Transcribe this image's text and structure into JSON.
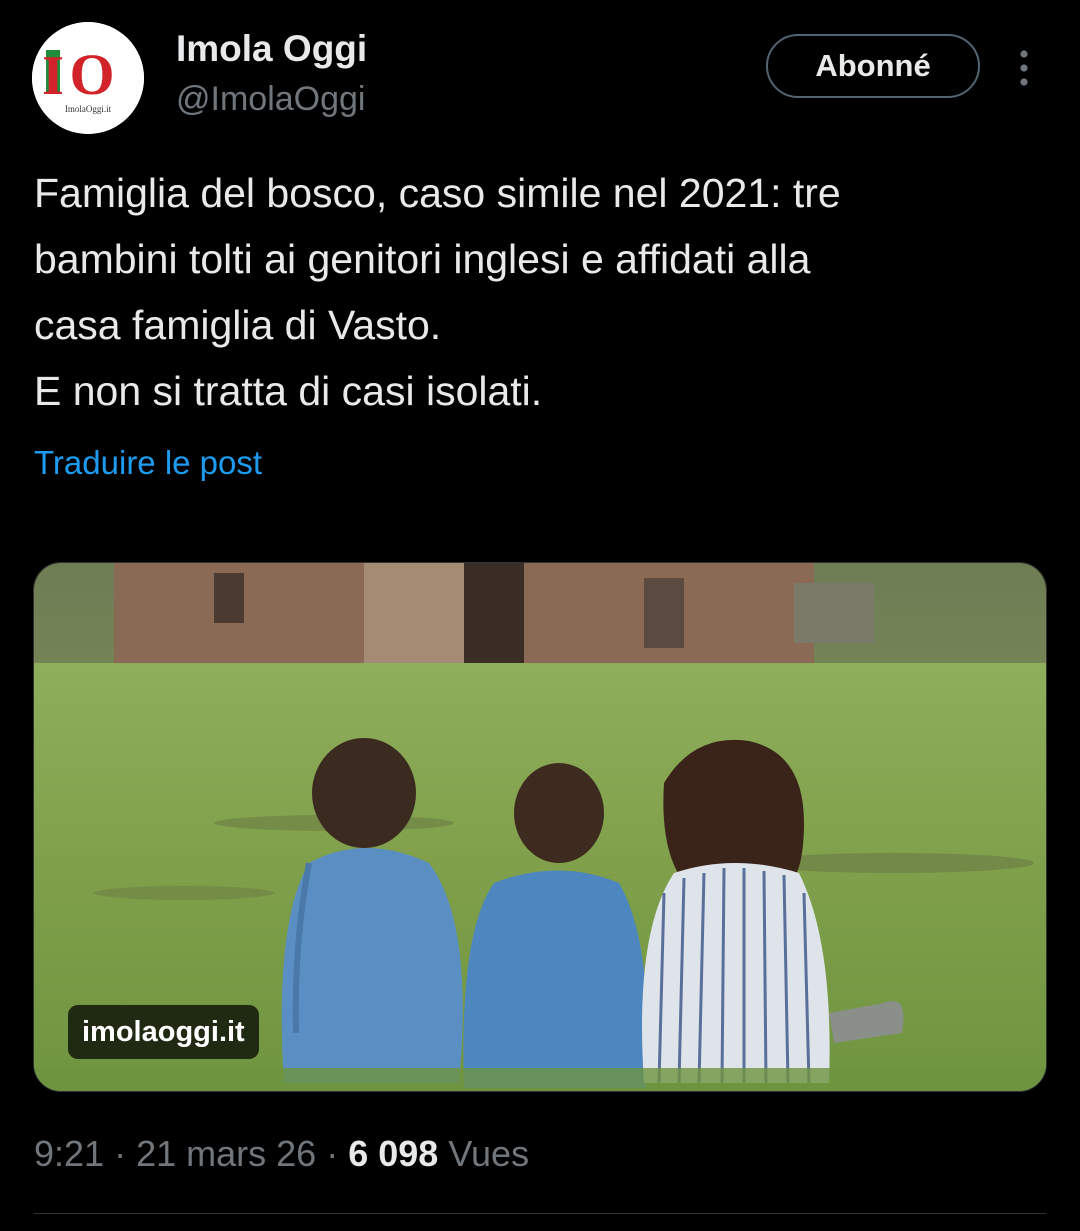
{
  "account": {
    "display_name": "Imola Oggi",
    "handle": "@ImolaOggi",
    "avatar_logo_text": "IO",
    "avatar_subtext": "ImolaOggi.it",
    "follow_button_label": "Abonné"
  },
  "tweet": {
    "text": "Famiglia del bosco, caso simile nel 2021: tre\nbambini tolti ai genitori inglesi e affidati alla\ncasa famiglia di Vasto.\nE non si tratta di casi isolati.",
    "translate_link": "Traduire le post",
    "media_source_badge": "imolaoggi.it",
    "time": "9:21",
    "date": "21 mars 26",
    "separator": "·",
    "views_count": "6 098",
    "views_label": "Vues"
  },
  "colors": {
    "background": "#000000",
    "text_primary": "#e7e9ea",
    "text_secondary": "#71767b",
    "link": "#1d9bf0",
    "logo_red": "#d2232a",
    "logo_green": "#1e8c3a"
  },
  "icons": {
    "more": "more-vertical-icon"
  }
}
